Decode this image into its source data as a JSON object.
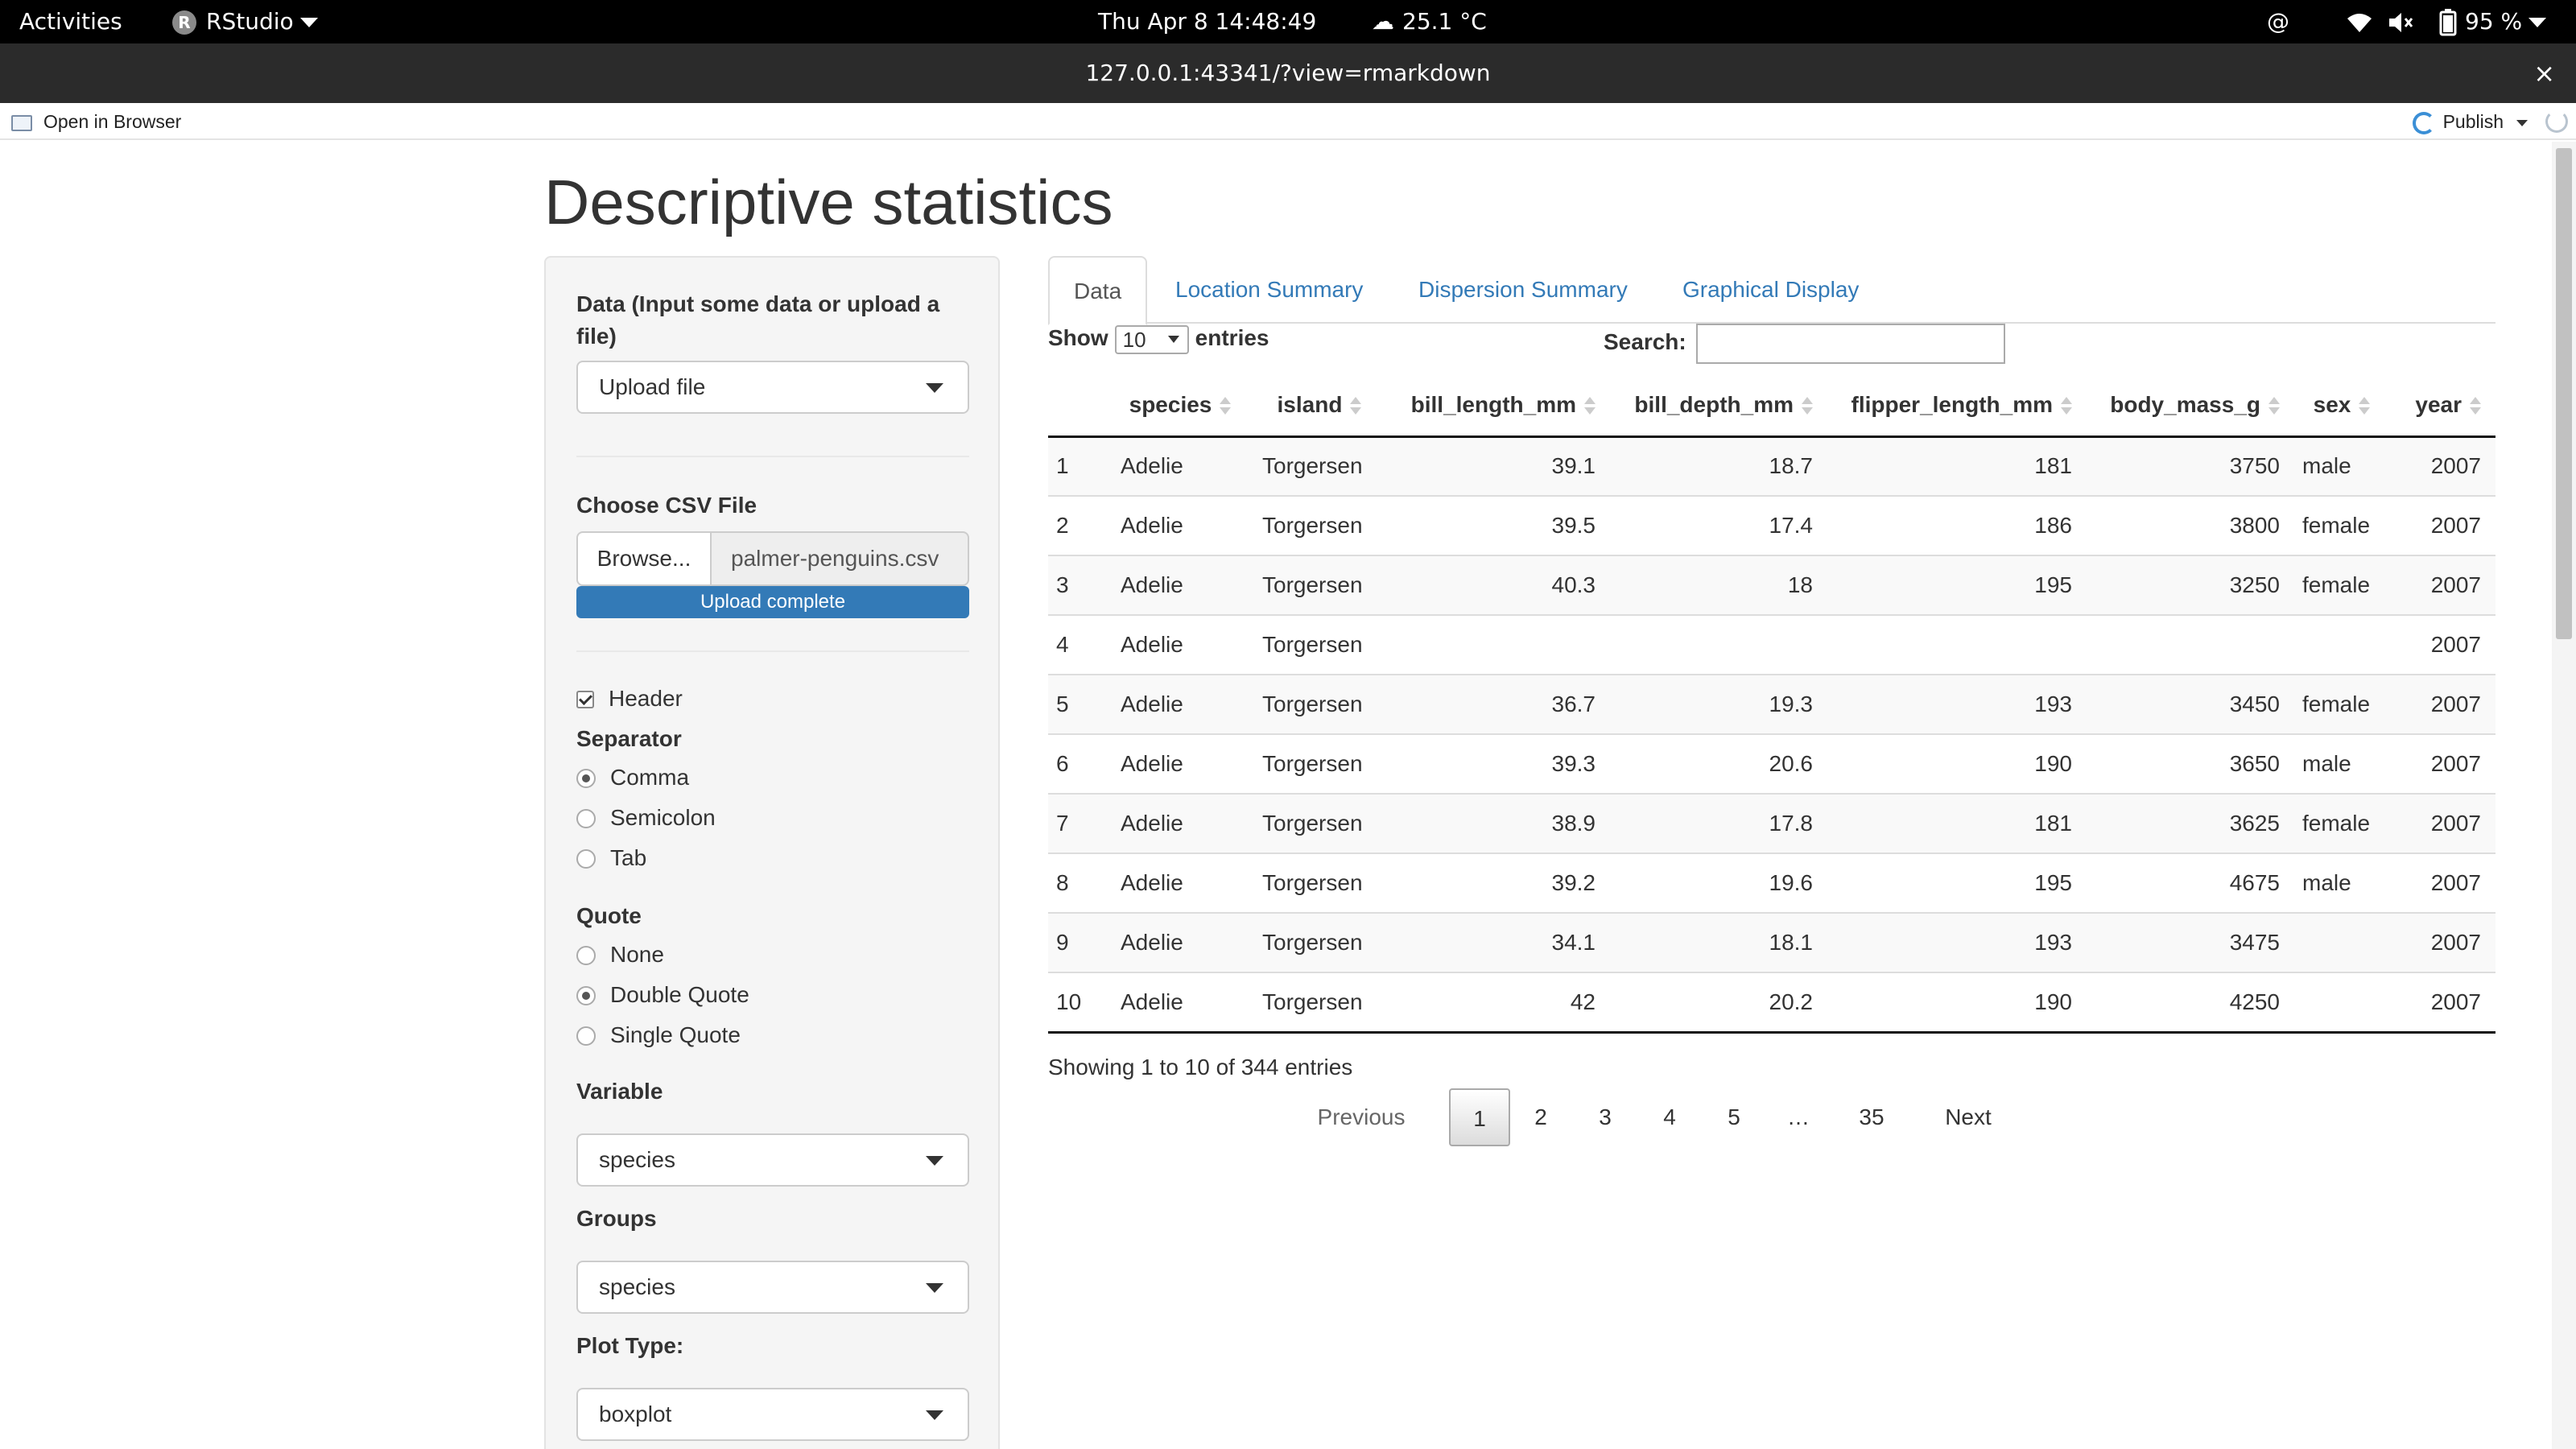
{
  "system_bar": {
    "activities": "Activities",
    "app_name": "RStudio",
    "datetime": "Thu Apr 8  14:48:49",
    "weather": "25.1 °C",
    "battery": "95 %"
  },
  "window": {
    "url": "127.0.0.1:43341/?view=rmarkdown",
    "close": "×"
  },
  "viewer_toolbar": {
    "open_in_browser": "Open in Browser",
    "publish": "Publish"
  },
  "page": {
    "title": "Descriptive statistics"
  },
  "sidebar": {
    "data_label": "Data (Input some data or upload a file)",
    "data_select": "Upload file",
    "file_label": "Choose CSV File",
    "browse": "Browse...",
    "file_name": "palmer-penguins.csv",
    "upload_status": "Upload complete",
    "header_label": "Header",
    "header_checked": true,
    "separator_label": "Separator",
    "separator_options": [
      "Comma",
      "Semicolon",
      "Tab"
    ],
    "separator_selected": "Comma",
    "quote_label": "Quote",
    "quote_options": [
      "None",
      "Double Quote",
      "Single Quote"
    ],
    "quote_selected": "Double Quote",
    "variable_label": "Variable",
    "variable_select": "species",
    "groups_label": "Groups",
    "groups_select": "species",
    "plot_type_label": "Plot Type:",
    "plot_type_select": "boxplot"
  },
  "tabs": [
    "Data",
    "Location Summary",
    "Dispersion Summary",
    "Graphical Display"
  ],
  "active_tab": "Data",
  "datatable": {
    "show_label": "Show",
    "length": "10",
    "entries_label": "entries",
    "search_label": "Search:",
    "columns": [
      "",
      "species",
      "island",
      "bill_length_mm",
      "bill_depth_mm",
      "flipper_length_mm",
      "body_mass_g",
      "sex",
      "year"
    ],
    "rows": [
      [
        "1",
        "Adelie",
        "Torgersen",
        "39.1",
        "18.7",
        "181",
        "3750",
        "male",
        "2007"
      ],
      [
        "2",
        "Adelie",
        "Torgersen",
        "39.5",
        "17.4",
        "186",
        "3800",
        "female",
        "2007"
      ],
      [
        "3",
        "Adelie",
        "Torgersen",
        "40.3",
        "18",
        "195",
        "3250",
        "female",
        "2007"
      ],
      [
        "4",
        "Adelie",
        "Torgersen",
        "",
        "",
        "",
        "",
        "",
        "2007"
      ],
      [
        "5",
        "Adelie",
        "Torgersen",
        "36.7",
        "19.3",
        "193",
        "3450",
        "female",
        "2007"
      ],
      [
        "6",
        "Adelie",
        "Torgersen",
        "39.3",
        "20.6",
        "190",
        "3650",
        "male",
        "2007"
      ],
      [
        "7",
        "Adelie",
        "Torgersen",
        "38.9",
        "17.8",
        "181",
        "3625",
        "female",
        "2007"
      ],
      [
        "8",
        "Adelie",
        "Torgersen",
        "39.2",
        "19.6",
        "195",
        "4675",
        "male",
        "2007"
      ],
      [
        "9",
        "Adelie",
        "Torgersen",
        "34.1",
        "18.1",
        "193",
        "3475",
        "",
        "2007"
      ],
      [
        "10",
        "Adelie",
        "Torgersen",
        "42",
        "20.2",
        "190",
        "4250",
        "",
        "2007"
      ]
    ],
    "info": "Showing 1 to 10 of 344 entries",
    "pagination": {
      "previous": "Previous",
      "pages": [
        "1",
        "2",
        "3",
        "4",
        "5",
        "…",
        "35"
      ],
      "current": "1",
      "next": "Next"
    }
  }
}
